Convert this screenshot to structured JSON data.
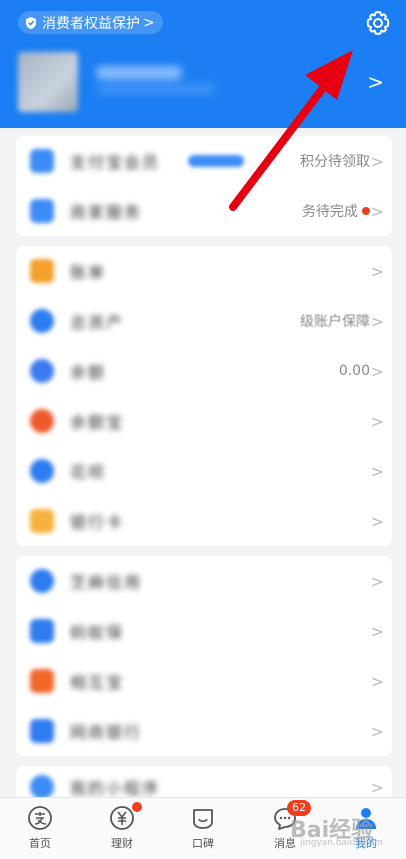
{
  "header": {
    "consumer_protection": "消费者权益保护",
    "chevron": ">"
  },
  "card1": {
    "rows": [
      {
        "label": "支付宝会员",
        "value": "积分待领取",
        "chevron": ">",
        "color": "#3b8cf6"
      },
      {
        "label": "商家服务",
        "value": "务待完成",
        "chevron": ">",
        "color": "#3b8cf6"
      }
    ]
  },
  "card2": {
    "rows": [
      {
        "label": "账单",
        "value": "",
        "chevron": ">",
        "color": "#f4a02c"
      },
      {
        "label": "总资产",
        "value": "级账户保障",
        "chevron": ">",
        "color": "#2d7cf0"
      },
      {
        "label": "余额",
        "value": "0.00",
        "chevron": ">",
        "color": "#3a7bf0"
      },
      {
        "label": "余额宝",
        "value": "",
        "chevron": ">",
        "color": "#ef5a2d"
      },
      {
        "label": "花呗",
        "value": "",
        "chevron": ">",
        "color": "#2d7cf0"
      },
      {
        "label": "银行卡",
        "value": "",
        "chevron": ">",
        "color": "#f6b23d"
      }
    ]
  },
  "card3": {
    "rows": [
      {
        "label": "芝麻信用",
        "value": "",
        "chevron": ">",
        "color": "#2d7cf0"
      },
      {
        "label": "蚂蚁保",
        "value": "",
        "chevron": ">",
        "color": "#2d7cf0"
      },
      {
        "label": "相互宝",
        "value": "",
        "chevron": ">",
        "color": "#f1682b"
      },
      {
        "label": "网商银行",
        "value": "",
        "chevron": ">",
        "color": "#2d7cf0"
      }
    ]
  },
  "card4": {
    "rows": [
      {
        "label": "我的小程序",
        "value": "",
        "chevron": ">",
        "color": "#3b8cf6"
      }
    ]
  },
  "tabbar": {
    "tabs": [
      {
        "label": "首页",
        "icon": "alipay-icon"
      },
      {
        "label": "理财",
        "icon": "yuan-icon"
      },
      {
        "label": "口碑",
        "icon": "koubei-icon"
      },
      {
        "label": "消息",
        "icon": "chat-icon",
        "badge": "62"
      },
      {
        "label": "我的",
        "icon": "person-icon"
      }
    ]
  },
  "watermark": {
    "text": "Bai经验",
    "sub": "jingyan.baidu.com"
  },
  "colors": {
    "brand": "#1b7ef2",
    "alert": "#f23c1e",
    "promo": "#f39a2b",
    "arrow": "#e60012"
  }
}
